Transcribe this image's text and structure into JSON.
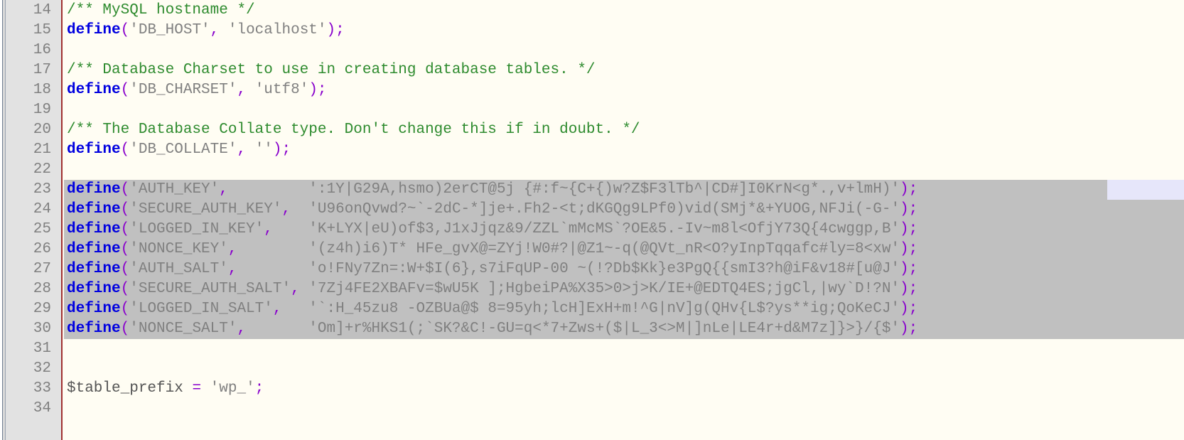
{
  "editor": {
    "language": "php",
    "gutter_start_line": 14,
    "colors": {
      "background": "#fffdf3",
      "gutter_background": "#e2e2e2",
      "gutter_text": "#808080",
      "selection": "#c0c0c0",
      "margin_rule": "#a03030",
      "comment": "#2e8b2e",
      "keyword": "#0000e0",
      "punctuation": "#8800cc",
      "string": "#808080",
      "edge_chip": "#e6e6fa"
    }
  },
  "line_numbers": [
    "14",
    "15",
    "16",
    "17",
    "18",
    "19",
    "20",
    "21",
    "22",
    "23",
    "24",
    "25",
    "26",
    "27",
    "28",
    "29",
    "30",
    "31",
    "32",
    "33",
    "34"
  ],
  "lines": [
    {
      "number": "14",
      "selected": false,
      "tokens": [
        {
          "cls": "t-comment",
          "text": "/** MySQL hostname */"
        }
      ]
    },
    {
      "number": "15",
      "selected": false,
      "tokens": [
        {
          "cls": "t-keyword",
          "text": "define"
        },
        {
          "cls": "t-punct",
          "text": "("
        },
        {
          "cls": "t-string",
          "text": "'DB_HOST'"
        },
        {
          "cls": "t-punct",
          "text": ","
        },
        {
          "cls": "t-plain",
          "text": " "
        },
        {
          "cls": "t-string",
          "text": "'localhost'"
        },
        {
          "cls": "t-punct",
          "text": ");"
        }
      ]
    },
    {
      "number": "16",
      "selected": false,
      "tokens": []
    },
    {
      "number": "17",
      "selected": false,
      "tokens": [
        {
          "cls": "t-comment",
          "text": "/** Database Charset to use in creating database tables. */"
        }
      ]
    },
    {
      "number": "18",
      "selected": false,
      "tokens": [
        {
          "cls": "t-keyword",
          "text": "define"
        },
        {
          "cls": "t-punct",
          "text": "("
        },
        {
          "cls": "t-string",
          "text": "'DB_CHARSET'"
        },
        {
          "cls": "t-punct",
          "text": ","
        },
        {
          "cls": "t-plain",
          "text": " "
        },
        {
          "cls": "t-string",
          "text": "'utf8'"
        },
        {
          "cls": "t-punct",
          "text": ");"
        }
      ]
    },
    {
      "number": "19",
      "selected": false,
      "tokens": []
    },
    {
      "number": "20",
      "selected": false,
      "tokens": [
        {
          "cls": "t-comment",
          "text": "/** The Database Collate type. Don't change this if in doubt. */"
        }
      ]
    },
    {
      "number": "21",
      "selected": false,
      "tokens": [
        {
          "cls": "t-keyword",
          "text": "define"
        },
        {
          "cls": "t-punct",
          "text": "("
        },
        {
          "cls": "t-string",
          "text": "'DB_COLLATE'"
        },
        {
          "cls": "t-punct",
          "text": ","
        },
        {
          "cls": "t-plain",
          "text": " "
        },
        {
          "cls": "t-string",
          "text": "''"
        },
        {
          "cls": "t-punct",
          "text": ");"
        }
      ]
    },
    {
      "number": "22",
      "selected": false,
      "tokens": []
    },
    {
      "number": "23",
      "selected": true,
      "tokens": [
        {
          "cls": "t-keyword",
          "text": "define"
        },
        {
          "cls": "t-punct",
          "text": "("
        },
        {
          "cls": "t-string",
          "text": "'AUTH_KEY'"
        },
        {
          "cls": "t-punct",
          "text": ","
        },
        {
          "cls": "t-plain",
          "text": "         "
        },
        {
          "cls": "t-string",
          "text": "':1Y|G29A,hsmo)2erCT@5j {#:f~{C+{)w?Z$F3lTb^|CD#]I0KrN<g*.,v+lmH)'"
        },
        {
          "cls": "t-punct",
          "text": ");"
        }
      ]
    },
    {
      "number": "24",
      "selected": true,
      "tokens": [
        {
          "cls": "t-keyword",
          "text": "define"
        },
        {
          "cls": "t-punct",
          "text": "("
        },
        {
          "cls": "t-string",
          "text": "'SECURE_AUTH_KEY'"
        },
        {
          "cls": "t-punct",
          "text": ","
        },
        {
          "cls": "t-plain",
          "text": "  "
        },
        {
          "cls": "t-string",
          "text": "'U96onQvwd?~`-2dC-*]je+.Fh2-<t;dKGQg9LPf0)vid(SMj*&+YUOG,NFJi(-G-'"
        },
        {
          "cls": "t-punct",
          "text": ");"
        }
      ]
    },
    {
      "number": "25",
      "selected": true,
      "tokens": [
        {
          "cls": "t-keyword",
          "text": "define"
        },
        {
          "cls": "t-punct",
          "text": "("
        },
        {
          "cls": "t-string",
          "text": "'LOGGED_IN_KEY'"
        },
        {
          "cls": "t-punct",
          "text": ","
        },
        {
          "cls": "t-plain",
          "text": "    "
        },
        {
          "cls": "t-string",
          "text": "'K+LYX|eU)of$3,J1xJjqz&9/ZZL`mMcMS`?OE&5.-Iv~m8l<OfjY73Q{4cwggp,B'"
        },
        {
          "cls": "t-punct",
          "text": ");"
        }
      ]
    },
    {
      "number": "26",
      "selected": true,
      "tokens": [
        {
          "cls": "t-keyword",
          "text": "define"
        },
        {
          "cls": "t-punct",
          "text": "("
        },
        {
          "cls": "t-string",
          "text": "'NONCE_KEY'"
        },
        {
          "cls": "t-punct",
          "text": ","
        },
        {
          "cls": "t-plain",
          "text": "        "
        },
        {
          "cls": "t-string",
          "text": "'(z4h)i6)T* HFe_gvX@=ZYj!W0#?|@Z1~-q(@QVt_nR<O?yInpTqqafc#ly=8<xw'"
        },
        {
          "cls": "t-punct",
          "text": ");"
        }
      ]
    },
    {
      "number": "27",
      "selected": true,
      "tokens": [
        {
          "cls": "t-keyword",
          "text": "define"
        },
        {
          "cls": "t-punct",
          "text": "("
        },
        {
          "cls": "t-string",
          "text": "'AUTH_SALT'"
        },
        {
          "cls": "t-punct",
          "text": ","
        },
        {
          "cls": "t-plain",
          "text": "        "
        },
        {
          "cls": "t-string",
          "text": "'o!FNy7Zn=:W+$I(6},s7iFqUP-00 ~(!?Db$Kk}e3PgQ{{smI3?h@iF&v18#[u@J'"
        },
        {
          "cls": "t-punct",
          "text": ");"
        }
      ]
    },
    {
      "number": "28",
      "selected": true,
      "tokens": [
        {
          "cls": "t-keyword",
          "text": "define"
        },
        {
          "cls": "t-punct",
          "text": "("
        },
        {
          "cls": "t-string",
          "text": "'SECURE_AUTH_SALT'"
        },
        {
          "cls": "t-punct",
          "text": ","
        },
        {
          "cls": "t-plain",
          "text": " "
        },
        {
          "cls": "t-string",
          "text": "'7Zj4FE2XBAFv=$wU5K ];HgbeiPA%X35>0>j>K/IE+@EDTQ4ES;jgCl,|wy`D!?N'"
        },
        {
          "cls": "t-punct",
          "text": ");"
        }
      ]
    },
    {
      "number": "29",
      "selected": true,
      "tokens": [
        {
          "cls": "t-keyword",
          "text": "define"
        },
        {
          "cls": "t-punct",
          "text": "("
        },
        {
          "cls": "t-string",
          "text": "'LOGGED_IN_SALT'"
        },
        {
          "cls": "t-punct",
          "text": ","
        },
        {
          "cls": "t-plain",
          "text": "   "
        },
        {
          "cls": "t-string",
          "text": "'`:H_45zu8 -OZBUa@$ 8=95yh;lcH]ExH+m!^G|nV]g(QHv{L$?ys**ig;QoKeCJ'"
        },
        {
          "cls": "t-punct",
          "text": ");"
        }
      ]
    },
    {
      "number": "30",
      "selected": true,
      "tokens": [
        {
          "cls": "t-keyword",
          "text": "define"
        },
        {
          "cls": "t-punct",
          "text": "("
        },
        {
          "cls": "t-string",
          "text": "'NONCE_SALT'"
        },
        {
          "cls": "t-punct",
          "text": ","
        },
        {
          "cls": "t-plain",
          "text": "       "
        },
        {
          "cls": "t-string",
          "text": "'Om]+r%HKS1(;`SK?&C!-GU=q<*7+Zws+($|L_3<>M|]nLe|LE4r+d&M7z]}>}/{$'"
        },
        {
          "cls": "t-punct",
          "text": ");"
        }
      ]
    },
    {
      "number": "31",
      "selected": false,
      "tokens": []
    },
    {
      "number": "32",
      "selected": false,
      "tokens": []
    },
    {
      "number": "33",
      "selected": false,
      "tokens": [
        {
          "cls": "t-var",
          "text": "$table_prefix"
        },
        {
          "cls": "t-plain",
          "text": " "
        },
        {
          "cls": "t-punct",
          "text": "="
        },
        {
          "cls": "t-plain",
          "text": " "
        },
        {
          "cls": "t-string",
          "text": "'wp_'"
        },
        {
          "cls": "t-punct",
          "text": ";"
        }
      ]
    },
    {
      "number": "34",
      "selected": false,
      "tokens": []
    }
  ]
}
